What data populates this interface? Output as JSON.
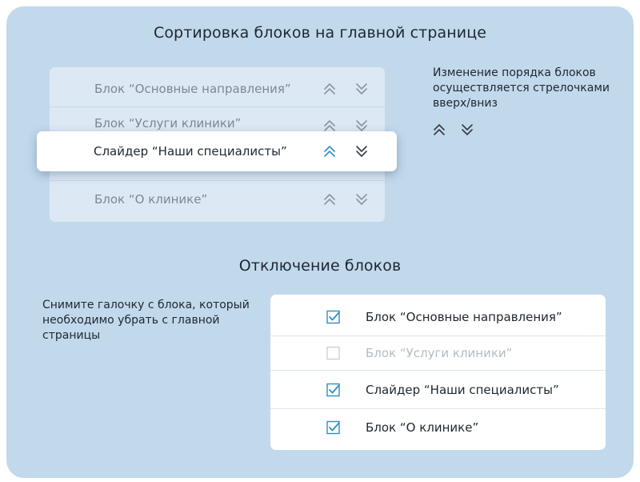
{
  "sort_section": {
    "title": "Сортировка блоков на главной странице",
    "rows": [
      {
        "label": "Блок “Основные направления”"
      },
      {
        "label": "Блок “Услуги клиники”"
      },
      {
        "label": "Слайдер “Наши специалисты”"
      },
      {
        "label": "Блок “О клинике”"
      }
    ],
    "hint": "Изменение порядка блоков осуществляется стрелочками вверх/вниз"
  },
  "disable_section": {
    "title": "Отключение блоков",
    "hint": "Снимите галочку с блока, который необходимо убрать с главной страницы",
    "rows": [
      {
        "label": "Блок “Основные направления”",
        "checked": true
      },
      {
        "label": "Блок “Услуги клиники”",
        "checked": false
      },
      {
        "label": "Слайдер “Наши специалисты”",
        "checked": true
      },
      {
        "label": "Блок “О клинике”",
        "checked": true
      }
    ]
  },
  "colors": {
    "panel": "#c2d9ec",
    "accent": "#2f8ec4",
    "muted_arrow": "#8a959e",
    "dark_arrow": "#333b42"
  },
  "icons": {
    "up": "double-chevron-up-icon",
    "down": "double-chevron-down-icon",
    "checked": "checkbox-checked-icon",
    "unchecked": "checkbox-empty-icon"
  }
}
